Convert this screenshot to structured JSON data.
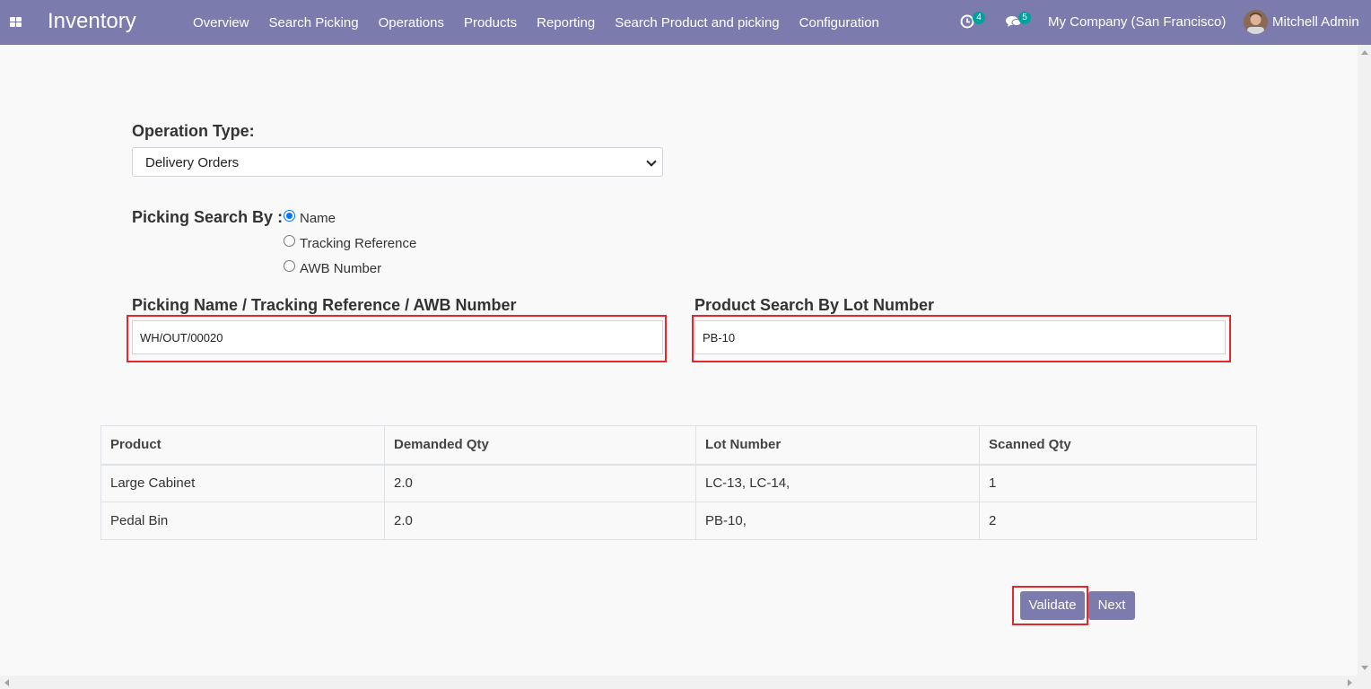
{
  "navbar": {
    "brand": "Inventory",
    "menu": [
      "Overview",
      "Search Picking",
      "Operations",
      "Products",
      "Reporting",
      "Search Product and picking",
      "Configuration"
    ],
    "activity_count": "4",
    "message_count": "5",
    "company": "My Company (San Francisco)",
    "user": "Mitchell Admin"
  },
  "form": {
    "operation_type_label": "Operation Type:",
    "operation_type_value": "Delivery Orders",
    "search_by_label": "Picking Search By :",
    "search_options": [
      "Name",
      "Tracking Reference",
      "AWB Number"
    ],
    "selected_option": "Name",
    "picking_label": "Picking Name / Tracking Reference / AWB Number",
    "picking_value": "WH/OUT/00020",
    "lot_label": "Product Search By Lot Number",
    "lot_value": "PB-10"
  },
  "table": {
    "headers": [
      "Product",
      "Demanded Qty",
      "Lot Number",
      "Scanned Qty"
    ],
    "rows": [
      [
        "Large Cabinet",
        "2.0",
        "LC-13, LC-14,",
        "1"
      ],
      [
        "Pedal Bin",
        "2.0",
        "PB-10,",
        "2"
      ]
    ]
  },
  "buttons": {
    "validate": "Validate",
    "next": "Next"
  },
  "colors": {
    "navbar": "#7c7bad",
    "highlight": "#e0282e",
    "badge": "#00a09d"
  }
}
